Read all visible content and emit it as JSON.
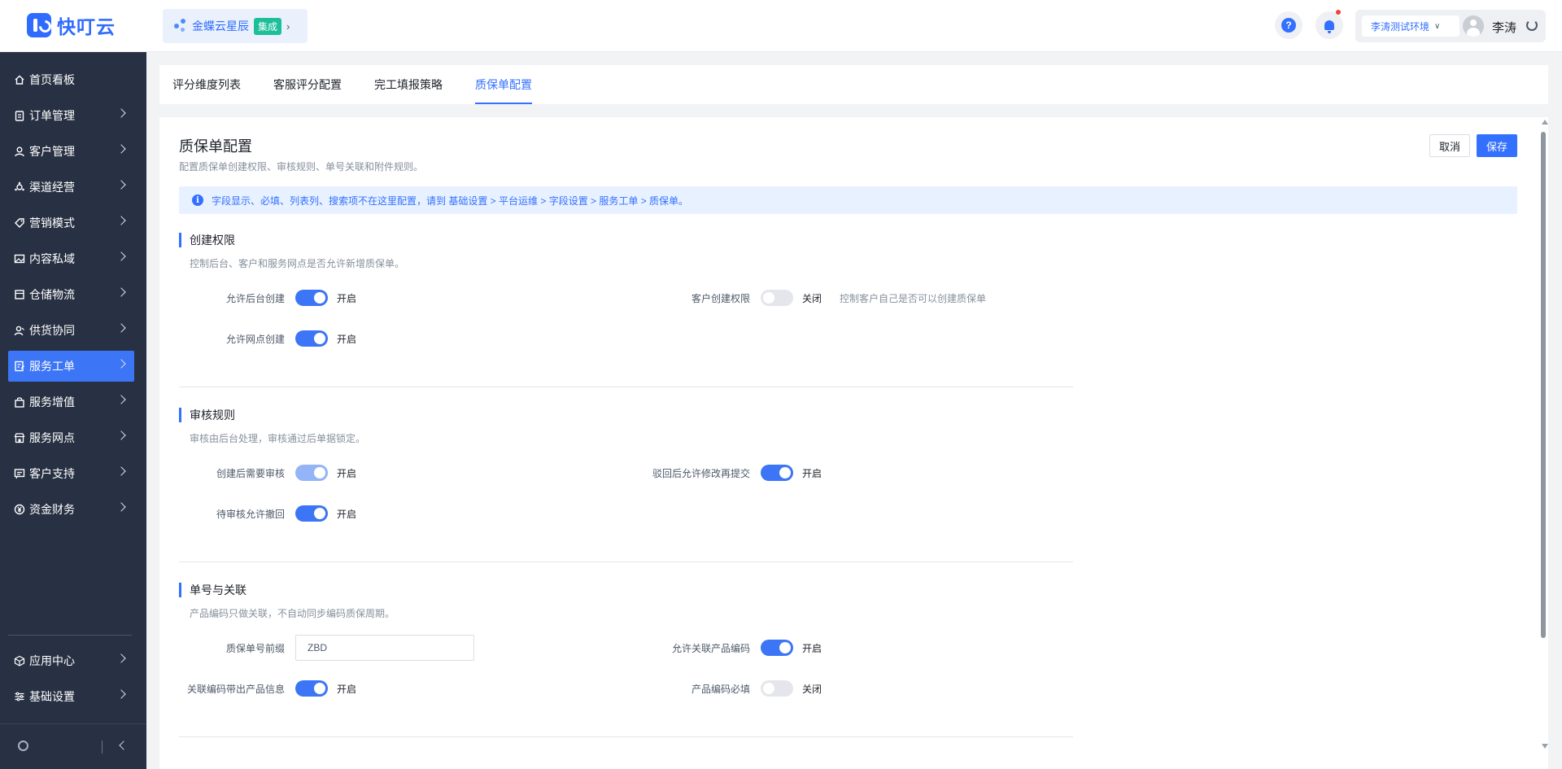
{
  "brand": {
    "name": "快叮云"
  },
  "tenant": {
    "name": "金蝶云星辰",
    "badge": "集成"
  },
  "header": {
    "environment": "李涛测试环境",
    "user_name": "李涛"
  },
  "sidebar": {
    "items": [
      {
        "label": "首页看板",
        "icon": "home-icon",
        "has_arrow": false
      },
      {
        "label": "订单管理",
        "icon": "clipboard-icon",
        "has_arrow": true
      },
      {
        "label": "客户管理",
        "icon": "user-icon",
        "has_arrow": true
      },
      {
        "label": "渠道经营",
        "icon": "channel-icon",
        "has_arrow": true
      },
      {
        "label": "营销模式",
        "icon": "tag-icon",
        "has_arrow": true
      },
      {
        "label": "内容私域",
        "icon": "image-icon",
        "has_arrow": true
      },
      {
        "label": "仓储物流",
        "icon": "box-icon",
        "has_arrow": true
      },
      {
        "label": "供货协同",
        "icon": "supply-icon",
        "has_arrow": true
      },
      {
        "label": "服务工单",
        "icon": "ticket-icon",
        "has_arrow": true,
        "active": true
      },
      {
        "label": "服务增值",
        "icon": "bag-icon",
        "has_arrow": true
      },
      {
        "label": "服务网点",
        "icon": "store-icon",
        "has_arrow": true
      },
      {
        "label": "客户支持",
        "icon": "support-icon",
        "has_arrow": true
      },
      {
        "label": "资金财务",
        "icon": "yen-icon",
        "has_arrow": true
      }
    ],
    "bottom_items": [
      {
        "label": "应用中心",
        "icon": "cube-icon"
      },
      {
        "label": "基础设置",
        "icon": "settings-icon"
      }
    ]
  },
  "tabs": [
    {
      "label": "评分维度列表"
    },
    {
      "label": "客服评分配置"
    },
    {
      "label": "完工填报策略"
    },
    {
      "label": "质保单配置",
      "active": true
    }
  ],
  "page": {
    "title": "质保单配置",
    "description": "配置质保单创建权限、审核规则、单号关联和附件规则。",
    "cancel_label": "取消",
    "save_label": "保存",
    "notice": "字段显示、必填、列表列、搜索项不在这里配置，请到 基础设置 > 平台运维 > 字段设置 > 服务工单 > 质保单。"
  },
  "sections": {
    "create": {
      "title": "创建权限",
      "desc": "控制后台、客户和服务网点是否允许新增质保单。",
      "rows": [
        {
          "label": "允许后台创建",
          "on": true,
          "state": "开启"
        },
        {
          "label": "客户创建权限",
          "on": false,
          "state": "关闭",
          "hint": "控制客户自己是否可以创建质保单"
        },
        {
          "label": "允许网点创建",
          "on": true,
          "state": "开启"
        }
      ]
    },
    "audit": {
      "title": "审核规则",
      "desc": "审核由后台处理，审核通过后单据锁定。",
      "rows": [
        {
          "label": "创建后需要审核",
          "on": true,
          "disabled": true,
          "state": "开启"
        },
        {
          "label": "驳回后允许修改再提交",
          "on": true,
          "state": "开启"
        },
        {
          "label": "待审核允许撤回",
          "on": true,
          "state": "开启"
        }
      ]
    },
    "number": {
      "title": "单号与关联",
      "desc": "产品编码只做关联，不自动同步编码质保周期。",
      "rows": [
        {
          "label": "质保单号前缀",
          "value": "ZBD"
        },
        {
          "label": "允许关联产品编码",
          "on": true,
          "state": "开启"
        },
        {
          "label": "关联编码带出产品信息",
          "on": true,
          "state": "开启"
        },
        {
          "label": "产品编码必填",
          "on": false,
          "state": "关闭"
        }
      ]
    }
  },
  "colors": {
    "primary": "#3370ff",
    "sidebar_bg": "#283143",
    "active_nav": "#3c75f5",
    "badge": "#1dbf9a"
  }
}
